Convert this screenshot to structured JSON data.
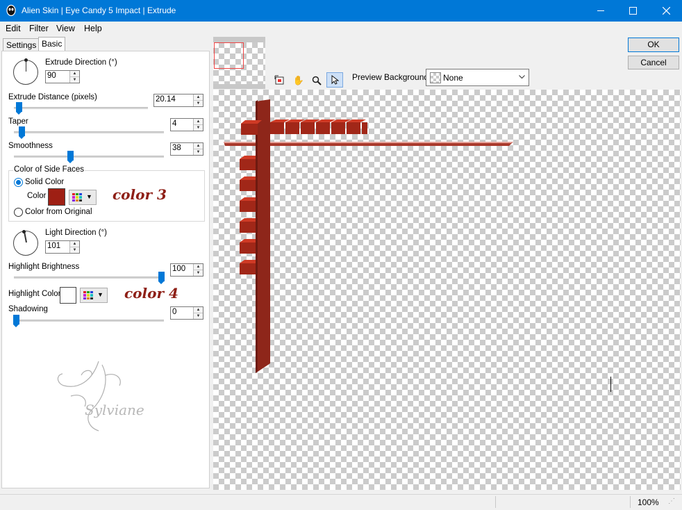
{
  "window": {
    "title": "Alien Skin | Eye Candy 5 Impact | Extrude"
  },
  "menu": {
    "edit": "Edit",
    "filter": "Filter",
    "view": "View",
    "help": "Help"
  },
  "tabs": [
    {
      "label": "Settings"
    },
    {
      "label": "Basic"
    }
  ],
  "basic": {
    "extrude_direction": {
      "label": "Extrude Direction (°)",
      "value": "90"
    },
    "extrude_distance": {
      "label": "Extrude Distance (pixels)",
      "value": "20.14"
    },
    "taper": {
      "label": "Taper",
      "value": "4"
    },
    "smoothness": {
      "label": "Smoothness",
      "value": "38"
    },
    "side_faces": {
      "group_label": "Color of Side Faces",
      "solid_color_label": "Solid Color",
      "color_label": "Color",
      "color_value": "#9e1f14",
      "from_original_label": "Color from Original",
      "annotation": "color 3"
    },
    "light_direction": {
      "label": "Light Direction (°)",
      "value": "101"
    },
    "highlight_brightness": {
      "label": "Highlight Brightness",
      "value": "100"
    },
    "highlight_color": {
      "label": "Highlight Color",
      "color_value": "#ffffff",
      "annotation": "color 4"
    },
    "shadowing": {
      "label": "Shadowing",
      "value": "0"
    },
    "watermark": "Sylviane"
  },
  "buttons": {
    "ok": "OK",
    "cancel": "Cancel"
  },
  "preview": {
    "background_label": "Preview Background:",
    "background_value": "None"
  },
  "status": {
    "zoom": "100%"
  },
  "colors": {
    "titlebar": "#0078d7",
    "accent": "#0078d7",
    "extrude": "#9e2a1c"
  },
  "icons": [
    "app-icon",
    "minimize-icon",
    "maximize-icon",
    "close-icon",
    "navigator-icon",
    "hand-icon",
    "zoom-icon",
    "pointer-icon",
    "chevron-down-icon",
    "palette-icon"
  ]
}
